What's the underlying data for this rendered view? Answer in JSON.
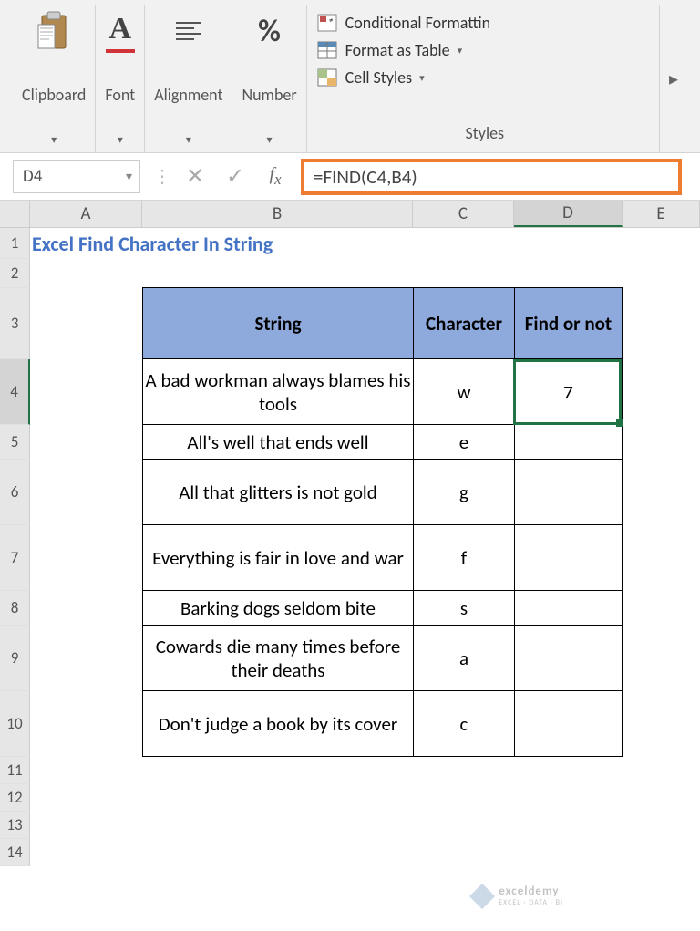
{
  "ribbon": {
    "clipboard": "Clipboard",
    "font": "Font",
    "alignment": "Alignment",
    "number": "Number",
    "conditional": "Conditional Formattin",
    "format_table": "Format as Table",
    "cell_styles": "Cell Styles",
    "styles_caption": "Styles"
  },
  "namebox": "D4",
  "formula": "=FIND(C4,B4)",
  "columns": [
    "A",
    "B",
    "C",
    "D",
    "E"
  ],
  "rows": [
    "1",
    "2",
    "3",
    "4",
    "5",
    "6",
    "7",
    "8",
    "9",
    "10",
    "11",
    "12",
    "13",
    "14"
  ],
  "title": "Excel Find Character In String",
  "headers": {
    "string": "String",
    "char": "Character",
    "find": "Find or not"
  },
  "data": [
    {
      "s": "A bad workman always blames his tools",
      "c": "w",
      "f": "7"
    },
    {
      "s": "All's well that ends well",
      "c": "e",
      "f": ""
    },
    {
      "s": "All that glitters is not gold",
      "c": "g",
      "f": ""
    },
    {
      "s": "Everything is fair in love and war",
      "c": "f",
      "f": ""
    },
    {
      "s": "Barking dogs seldom bite",
      "c": "s",
      "f": ""
    },
    {
      "s": "Cowards die many times before their deaths",
      "c": "a",
      "f": ""
    },
    {
      "s": "Don't judge a book by its cover",
      "c": "c",
      "f": ""
    }
  ],
  "watermark": {
    "name": "exceldemy",
    "tag": "EXCEL · DATA · BI"
  }
}
